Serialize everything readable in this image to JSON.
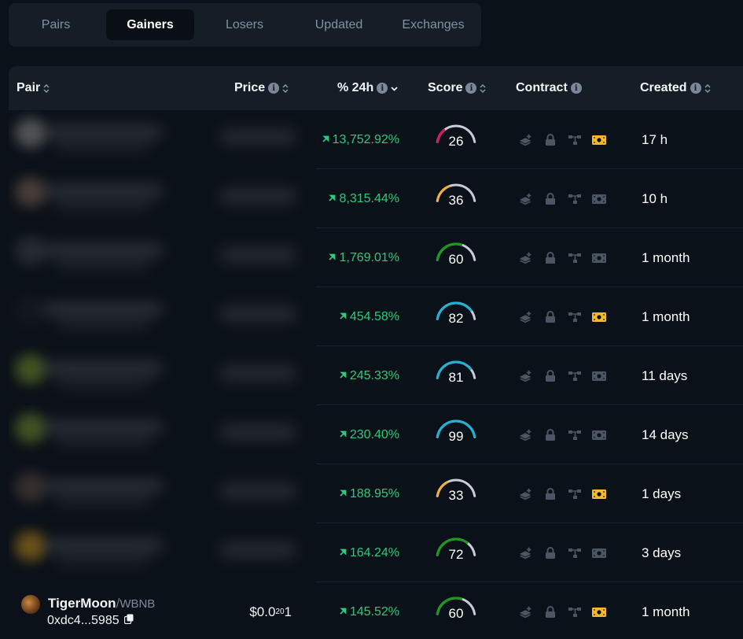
{
  "tabs": [
    {
      "label": "Pairs",
      "active": false
    },
    {
      "label": "Gainers",
      "active": true
    },
    {
      "label": "Losers",
      "active": false
    },
    {
      "label": "Updated",
      "active": false
    },
    {
      "label": "Exchanges",
      "active": false
    }
  ],
  "columns": {
    "pair": "Pair",
    "price": "Price",
    "change": "% 24h",
    "score": "Score",
    "contract": "Contract",
    "created": "Created"
  },
  "colors": {
    "gain": "#2ec97a",
    "score_red": "#d81b60",
    "score_orange": "#f0b03c",
    "score_green": "#1a9a1a",
    "score_blue": "#1eb4d8",
    "gauge_track": "#c8ccd6",
    "contract_icon_muted": "#4b5563",
    "contract_icon_active": "#f3b82e"
  },
  "rows": [
    {
      "blurred": true,
      "avatar_color": "#8a8a8a",
      "change": "13,752.92%",
      "score": 26,
      "score_color": "#d81b60",
      "money_active": true,
      "created": "17 h"
    },
    {
      "blurred": true,
      "avatar_color": "#7a6050",
      "change": "8,315.44%",
      "score": 36,
      "score_color": "#f0b03c",
      "money_active": false,
      "created": "10 h"
    },
    {
      "blurred": true,
      "avatar_color": "#3a4048",
      "change": "1,769.01%",
      "score": 60,
      "score_color": "#1a9a1a",
      "money_active": false,
      "created": "1 month"
    },
    {
      "blurred": true,
      "avatar_color": "#1a1e24",
      "change": "454.58%",
      "score": 82,
      "score_color": "#1eb4d8",
      "money_active": true,
      "created": "1 month"
    },
    {
      "blurred": true,
      "avatar_color": "#6e8a2a",
      "change": "245.33%",
      "score": 81,
      "score_color": "#1eb4d8",
      "money_active": false,
      "created": "11 days"
    },
    {
      "blurred": true,
      "avatar_color": "#6e8a2a",
      "change": "230.40%",
      "score": 99,
      "score_color": "#1eb4d8",
      "money_active": false,
      "created": "14 days"
    },
    {
      "blurred": true,
      "avatar_color": "#5a4840",
      "change": "188.95%",
      "score": 33,
      "score_color": "#f0b03c",
      "money_active": true,
      "created": "1 days"
    },
    {
      "blurred": true,
      "avatar_color": "#b8861a",
      "change": "164.24%",
      "score": 72,
      "score_color": "#1a9a1a",
      "money_active": false,
      "created": "3 days"
    },
    {
      "blurred": false,
      "token": "TigerMoon",
      "separator": "/",
      "quote": "WBNB",
      "address": "0xdc4...5985",
      "price_prefix": "$0.0",
      "price_zeros": "20",
      "price_digits": "1",
      "change": "145.52%",
      "score": 60,
      "score_color": "#1a9a1a",
      "money_active": true,
      "created": "1 month"
    }
  ]
}
